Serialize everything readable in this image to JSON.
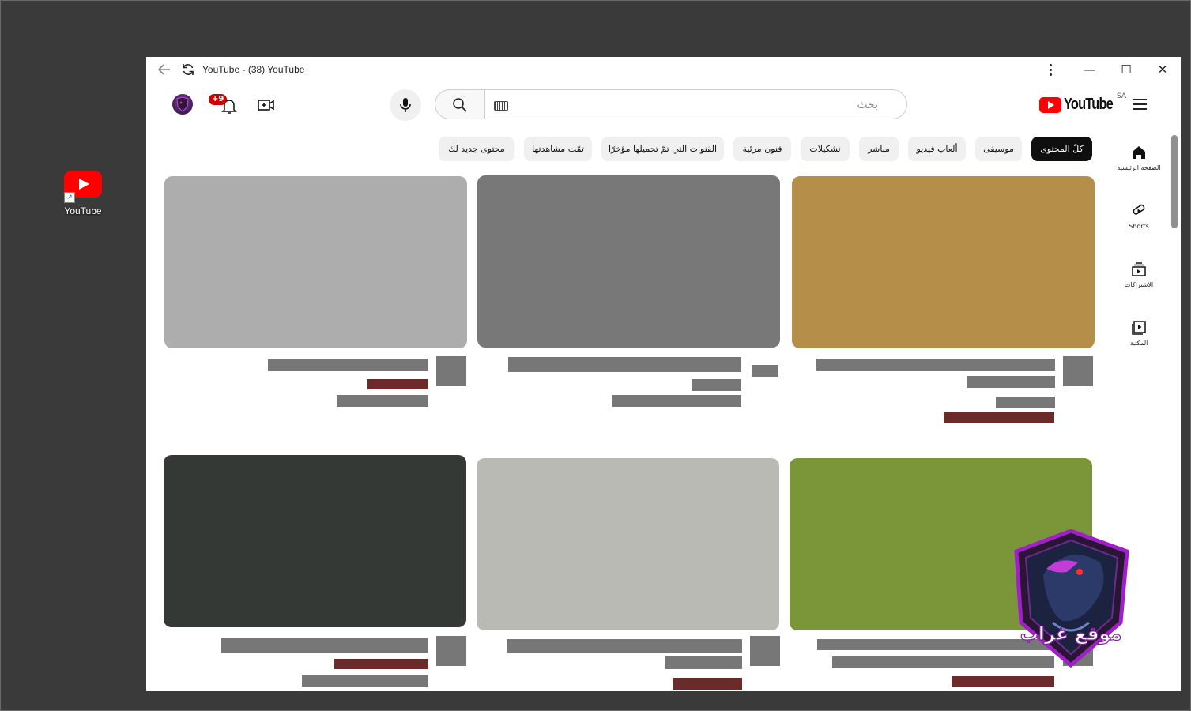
{
  "desktop": {
    "icon_label": "YouTube"
  },
  "window": {
    "title": "YouTube - (38) YouTube",
    "minimize": "—",
    "maximize": "☐",
    "close": "✕"
  },
  "header": {
    "logo_text": "YouTube",
    "country_code": "SA",
    "search_placeholder": "بحث",
    "notifications_badge": "+9"
  },
  "guide": [
    {
      "label": "الصفحة الرئيسية",
      "icon": "home-icon"
    },
    {
      "label": "Shorts",
      "icon": "shorts-icon"
    },
    {
      "label": "الاشتراكات",
      "icon": "subscriptions-icon"
    },
    {
      "label": "المكتبة",
      "icon": "library-icon"
    }
  ],
  "chips": [
    {
      "label": "كلّ المحتوى",
      "active": true
    },
    {
      "label": "موسيقى"
    },
    {
      "label": "ألعاب فيديو"
    },
    {
      "label": "مباشر"
    },
    {
      "label": "تشكيلات"
    },
    {
      "label": "فنون مرئية"
    },
    {
      "label": "القنوات التي تمّ تحميلها مؤخرًا"
    },
    {
      "label": "تمّت مشاهدتها"
    },
    {
      "label": "محتوى جديد لك"
    }
  ],
  "videos": [
    {
      "thumb_color": "#b58e4a"
    },
    {
      "thumb_color": "#787878"
    },
    {
      "thumb_color": "#adadad"
    },
    {
      "thumb_color": "#7a9638"
    },
    {
      "thumb_color": "#babab4"
    },
    {
      "thumb_color": "#343936"
    }
  ],
  "watermark": {
    "text": "موقع غراب"
  },
  "colors": {
    "brand_red": "#ff0000",
    "loading_bar": "#777777",
    "loading_bar_accent": "#6b2b2b"
  }
}
